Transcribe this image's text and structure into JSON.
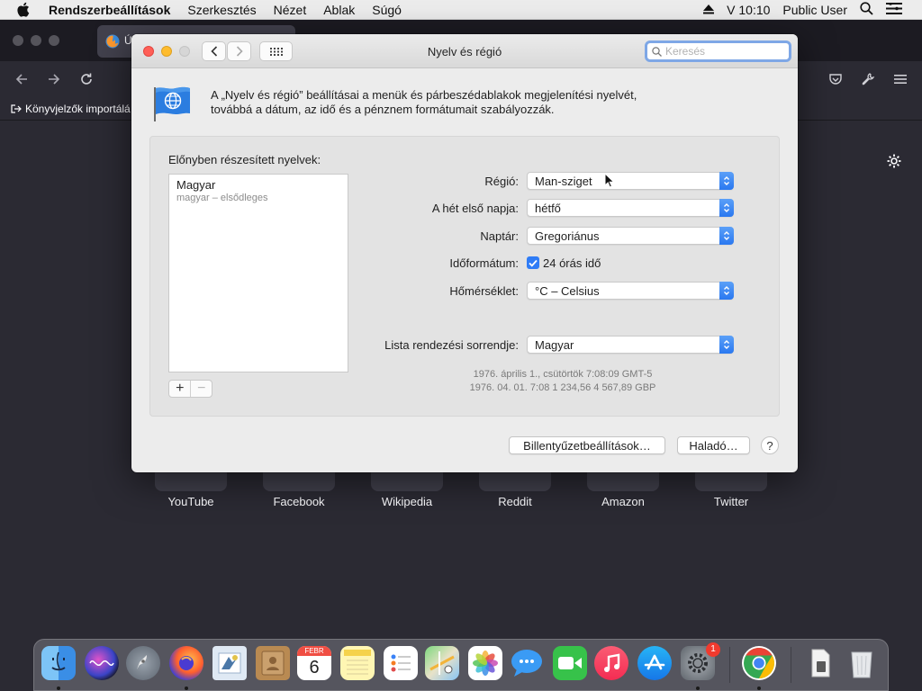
{
  "menubar": {
    "app": "Rendszerbeállítások",
    "items": [
      "Szerkesztés",
      "Nézet",
      "Ablak",
      "Súgó"
    ],
    "clock": "V 10:10",
    "user": "Public User"
  },
  "browser": {
    "tab_title": "Ú",
    "bookmark_import": "Könyvjelzők importálá",
    "sites": [
      "YouTube",
      "Facebook",
      "Wikipedia",
      "Reddit",
      "Amazon",
      "Twitter"
    ]
  },
  "window": {
    "title": "Nyelv és régió",
    "search_placeholder": "Keresés",
    "description_1": "A „Nyelv és régió” beállításai a menük és párbeszédablakok megjelenítési nyelvét,",
    "description_2": "továbbá a dátum, az idő és a pénznem formátumait szabályozzák.",
    "preferred_languages_label": "Előnyben részesített nyelvek:",
    "language": {
      "name": "Magyar",
      "detail": "magyar – elsődleges"
    },
    "add_label": "+",
    "remove_label": "−",
    "fields": {
      "region": {
        "label": "Régió:",
        "value": "Man-sziget"
      },
      "first_day": {
        "label": "A hét első napja:",
        "value": "hétfő"
      },
      "calendar": {
        "label": "Naptár:",
        "value": "Gregoriánus"
      },
      "time_format": {
        "label": "Időformátum:",
        "value": "24 órás idő",
        "checked": true
      },
      "temperature": {
        "label": "Hőmérséklet:",
        "value": "°C – Celsius"
      },
      "sort_order": {
        "label": "Lista rendezési sorrendje:",
        "value": "Magyar"
      }
    },
    "sample": {
      "line1": "1976. április 1., csütörtök 7:08:09 GMT-5",
      "date_short": "1976. 04. 01. 7:08",
      "number": "1 234,56",
      "currency": "4 567,89 GBP"
    },
    "buttons": {
      "keyboard": "Billentyűzetbeállítások…",
      "advanced": "Haladó…",
      "help": "?"
    }
  },
  "dock": {
    "apps": [
      "Finder",
      "Siri",
      "Launchpad",
      "Firefox",
      "Mail",
      "Contacts",
      "Calendar",
      "Notes",
      "Reminders",
      "Maps",
      "Photos",
      "Messages",
      "FaceTime",
      "Music",
      "App Store",
      "System Preferences",
      "Chrome",
      "Downloads",
      "Trash"
    ],
    "calendar_month": "FEBR",
    "calendar_day": "6",
    "prefs_badge": "1"
  }
}
